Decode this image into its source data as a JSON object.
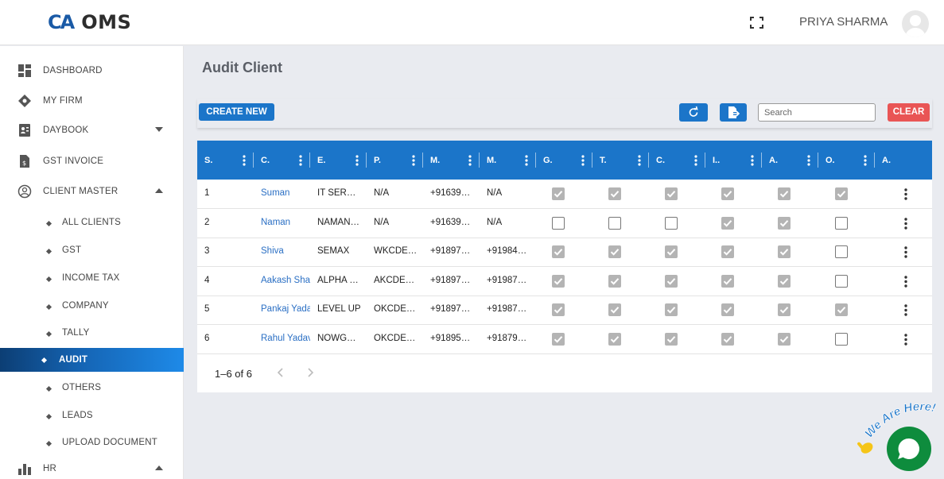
{
  "header": {
    "logo_mark": "CA",
    "logo_text": "OMS",
    "user_name": "PRIYA SHARMA"
  },
  "sidebar": {
    "items": [
      {
        "label": "DASHBOARD"
      },
      {
        "label": "MY FIRM"
      },
      {
        "label": "DAYBOOK"
      },
      {
        "label": "GST INVOICE"
      },
      {
        "label": "CLIENT MASTER"
      },
      {
        "label": "HR"
      }
    ],
    "client_master_sub": [
      {
        "label": "ALL CLIENTS"
      },
      {
        "label": "GST"
      },
      {
        "label": "INCOME TAX"
      },
      {
        "label": "COMPANY"
      },
      {
        "label": "TALLY"
      },
      {
        "label": "AUDIT"
      },
      {
        "label": "OTHERS"
      },
      {
        "label": "LEADS"
      },
      {
        "label": "UPLOAD DOCUMENT"
      }
    ]
  },
  "page": {
    "title": "Audit Client",
    "create_label": "CREATE NEW",
    "search_placeholder": "Search",
    "clear_label": "CLEAR"
  },
  "table": {
    "columns": [
      "S.",
      "C.",
      "E.",
      "P.",
      "M.",
      "M.",
      "G.",
      "T.",
      "C.",
      "I..",
      "A.",
      "O.",
      "A."
    ],
    "rows": [
      {
        "s": "1",
        "client": "Suman",
        "e": "IT SER…",
        "p": "N/A",
        "m1": "+91639…",
        "m2": "N/A",
        "checks": [
          true,
          true,
          true,
          true,
          true,
          true
        ]
      },
      {
        "s": "2",
        "client": "Naman",
        "e": "NAMAN…",
        "p": "N/A",
        "m1": "+91639…",
        "m2": "N/A",
        "checks": [
          false,
          false,
          false,
          true,
          true,
          false
        ]
      },
      {
        "s": "3",
        "client": "Shiva",
        "e": "SEMAX",
        "p": "WKCDE…",
        "m1": "+91897…",
        "m2": "+91984…",
        "checks": [
          true,
          true,
          true,
          true,
          true,
          false
        ]
      },
      {
        "s": "4",
        "client": "Aakash Shar",
        "e": "ALPHA …",
        "p": "AKCDE…",
        "m1": "+91897…",
        "m2": "+91987…",
        "checks": [
          true,
          true,
          true,
          true,
          true,
          false
        ]
      },
      {
        "s": "5",
        "client": "Pankaj Yada",
        "e": "LEVEL UP",
        "p": "OKCDE…",
        "m1": "+91897…",
        "m2": "+91987…",
        "checks": [
          true,
          true,
          true,
          true,
          true,
          true
        ]
      },
      {
        "s": "6",
        "client": "Rahul Yadav",
        "e": "NOWG…",
        "p": "OKCDE…",
        "m1": "+91895…",
        "m2": "+91879…",
        "checks": [
          true,
          true,
          true,
          true,
          true,
          false
        ]
      }
    ],
    "pager_text": "1–6 of 6"
  },
  "chat": {
    "badge_text": "We Are Here!"
  }
}
